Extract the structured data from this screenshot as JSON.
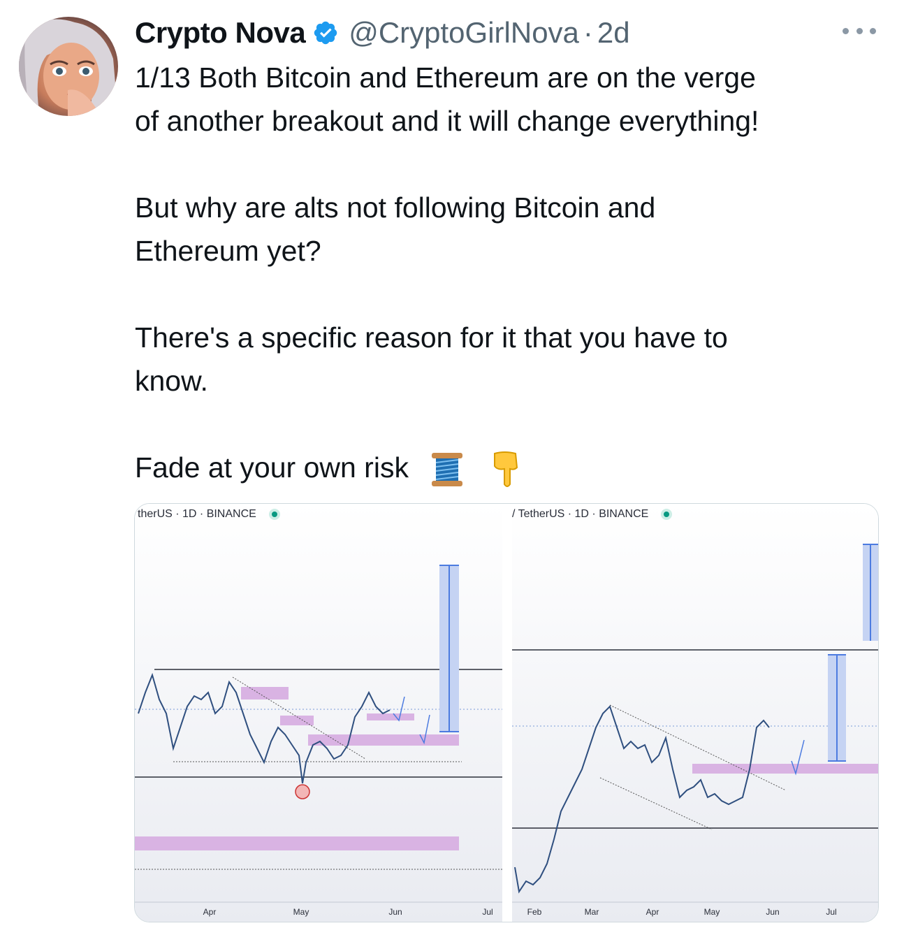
{
  "tweet": {
    "author_name": "Crypto Nova",
    "handle": "@CryptoGirlNova",
    "separator": "·",
    "time": "2d",
    "verified_color": "#1d9bf0",
    "paragraphs": [
      [
        "1/13 Both Bitcoin and Ethereum are on the verge",
        "of another breakout and it will change everything!"
      ],
      [
        "But why are alts not following Bitcoin and",
        "Ethereum yet?"
      ],
      [
        "There's a specific reason for it that you have to",
        "know."
      ],
      [
        "Fade at your own risk"
      ]
    ],
    "emojis": [
      "thread-spool-icon",
      "pointing-down-icon"
    ]
  },
  "media": {
    "left_chart": {
      "label": "therUS · 1D · BINANCE",
      "months": [
        "Apr",
        "May",
        "Jun",
        "Jul"
      ]
    },
    "right_chart": {
      "label": "/ TetherUS · 1D · BINANCE",
      "months": [
        "Feb",
        "Mar",
        "Apr",
        "May",
        "Jun",
        "Jul"
      ]
    },
    "colors": {
      "zone": "#d9b3e3",
      "projection": "#c5d3f3",
      "projection_line": "#4c7be0",
      "candle_up": "#2f4f7f",
      "candle_down": "#a33a3a",
      "live_dot": "#089981"
    }
  }
}
